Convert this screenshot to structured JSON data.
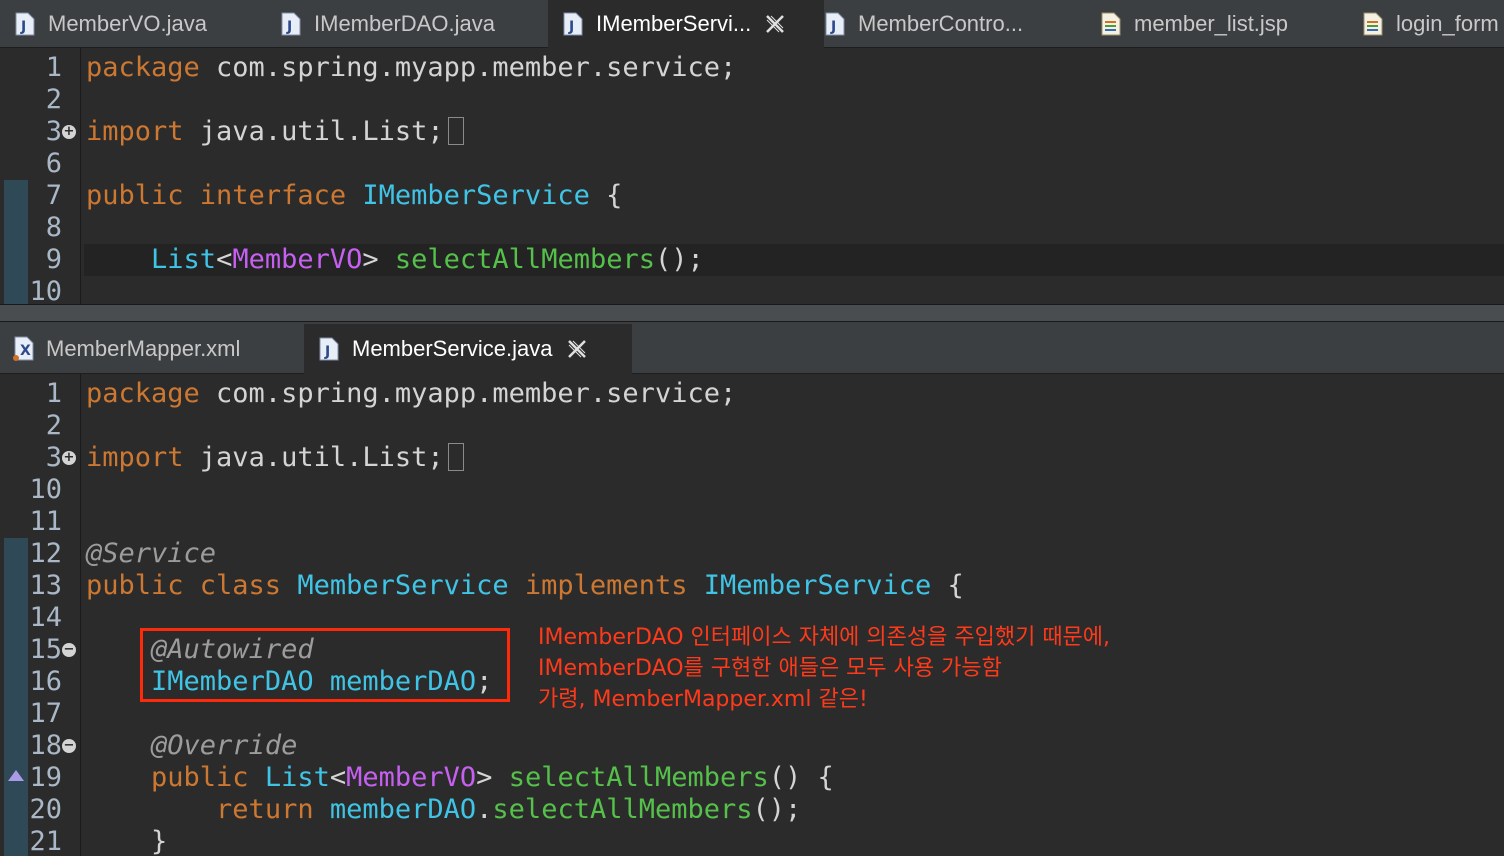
{
  "top_tabs": [
    {
      "label": "MemberVO.java",
      "icon": "java-file-icon",
      "active": false
    },
    {
      "label": "IMemberDAO.java",
      "icon": "java-file-icon",
      "active": false
    },
    {
      "label": "IMemberServi...",
      "icon": "java-file-icon",
      "active": true
    },
    {
      "label": "MemberContro...",
      "icon": "java-file-icon",
      "active": false
    },
    {
      "label": "member_list.jsp",
      "icon": "jsp-file-icon",
      "active": false
    },
    {
      "label": "login_form",
      "icon": "jsp-file-icon",
      "active": false
    }
  ],
  "top_editor": {
    "lines": [
      {
        "num": "1",
        "tokens": [
          [
            "kw",
            "package "
          ],
          [
            "pl",
            "com.spring.myapp.member.service;"
          ]
        ]
      },
      {
        "num": "2",
        "tokens": []
      },
      {
        "num": "3",
        "fold": "+",
        "tokens": [
          [
            "kw",
            "import "
          ],
          [
            "pl",
            "java.util.List;"
          ],
          [
            "ellipsis",
            ""
          ]
        ]
      },
      {
        "num": "6",
        "tokens": []
      },
      {
        "num": "7",
        "tokens": [
          [
            "kw",
            "public interface "
          ],
          [
            "ty",
            "IMemberService"
          ],
          [
            "pl",
            " {"
          ]
        ]
      },
      {
        "num": "8",
        "tokens": []
      },
      {
        "num": "9",
        "current": true,
        "tokens": [
          [
            "pl",
            "    "
          ],
          [
            "ty",
            "List"
          ],
          [
            "pl",
            "<"
          ],
          [
            "gen",
            "MemberVO"
          ],
          [
            "pl",
            "> "
          ],
          [
            "me",
            "selectAllMembers"
          ],
          [
            "pl",
            "();"
          ]
        ]
      },
      {
        "num": "10",
        "tokens": []
      }
    ]
  },
  "bottom_tabs": [
    {
      "label": "MemberMapper.xml",
      "icon": "xml-file-icon",
      "active": false
    },
    {
      "label": "MemberService.java",
      "icon": "java-file-icon",
      "active": true
    }
  ],
  "bottom_editor": {
    "lines": [
      {
        "num": "1",
        "tokens": [
          [
            "kw",
            "package "
          ],
          [
            "pl",
            "com.spring.myapp.member.service;"
          ]
        ]
      },
      {
        "num": "2",
        "tokens": []
      },
      {
        "num": "3",
        "fold": "+",
        "tokens": [
          [
            "kw",
            "import "
          ],
          [
            "pl",
            "java.util.List;"
          ],
          [
            "ellipsis",
            ""
          ]
        ]
      },
      {
        "num": "10",
        "tokens": []
      },
      {
        "num": "11",
        "tokens": []
      },
      {
        "num": "12",
        "tokens": [
          [
            "an",
            "@Service"
          ]
        ]
      },
      {
        "num": "13",
        "tokens": [
          [
            "kw",
            "public class "
          ],
          [
            "ty",
            "MemberService "
          ],
          [
            "kw",
            "implements "
          ],
          [
            "ty",
            "IMemberService"
          ],
          [
            "pl",
            " {"
          ]
        ]
      },
      {
        "num": "14",
        "tokens": []
      },
      {
        "num": "15",
        "fold": "-",
        "tokens": [
          [
            "pl",
            "    "
          ],
          [
            "an",
            "@Autowired"
          ]
        ]
      },
      {
        "num": "16",
        "tokens": [
          [
            "pl",
            "    "
          ],
          [
            "ty",
            "IMemberDAO memberDAO"
          ],
          [
            "pl",
            ";"
          ]
        ]
      },
      {
        "num": "17",
        "tokens": []
      },
      {
        "num": "18",
        "fold": "-",
        "tokens": [
          [
            "pl",
            "    "
          ],
          [
            "an",
            "@Override"
          ]
        ]
      },
      {
        "num": "19",
        "override": true,
        "tokens": [
          [
            "pl",
            "    "
          ],
          [
            "kw",
            "public "
          ],
          [
            "ty",
            "List"
          ],
          [
            "pl",
            "<"
          ],
          [
            "gen",
            "MemberVO"
          ],
          [
            "pl",
            "> "
          ],
          [
            "me",
            "selectAllMembers"
          ],
          [
            "pl",
            "() {"
          ]
        ]
      },
      {
        "num": "20",
        "tokens": [
          [
            "pl",
            "        "
          ],
          [
            "kw",
            "return "
          ],
          [
            "ty",
            "memberDAO"
          ],
          [
            "pl",
            "."
          ],
          [
            "me",
            "selectAllMembers"
          ],
          [
            "pl",
            "();"
          ]
        ]
      },
      {
        "num": "21",
        "tokens": [
          [
            "pl",
            "    }"
          ]
        ]
      }
    ]
  },
  "annotation": {
    "lines": [
      "IMemberDAO 인터페이스 자체에 의존성을 주입했기 때문에,",
      "IMemberDAO를 구현한 애들은 모두 사용 가능함",
      "가령, MemberMapper.xml 같은!"
    ],
    "color": "#ff3a1a"
  }
}
